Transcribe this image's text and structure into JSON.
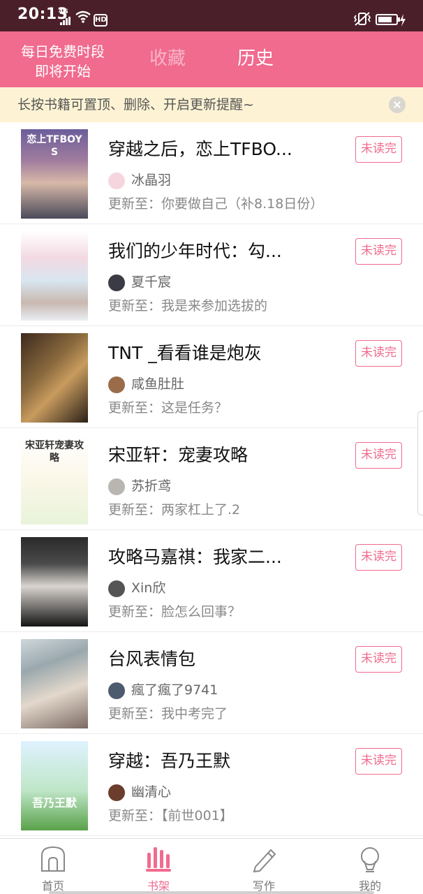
{
  "status_bar": {
    "time": "20:13",
    "network": "4G",
    "hd": "HD",
    "battery_level": 0.8
  },
  "header": {
    "promo_line1": "每日免费时段",
    "promo_line2": "即将开始",
    "tabs": [
      {
        "label": "收藏",
        "active": false
      },
      {
        "label": "历史",
        "active": true
      }
    ]
  },
  "tip_bar": {
    "text": "长按书籍可置顶、删除、开启更新提醒~"
  },
  "books": [
    {
      "title": "穿越之后，恋上TFBO...",
      "author": "冰晶羽",
      "update_prefix": "更新至：",
      "update": "你要做自己（补8.18日份）",
      "badge": "未读完",
      "cover_text": "恋上TFBOYS"
    },
    {
      "title": "我们的少年时代：勾...",
      "author": "夏千宸",
      "update_prefix": "更新至：",
      "update": "我是来参加选拔的",
      "badge": "未读完",
      "cover_text": ""
    },
    {
      "title": "TNT _看看谁是炮灰",
      "author": "咸鱼肚肚",
      "update_prefix": "更新至：",
      "update": "这是任务？",
      "badge": "未读完",
      "cover_text": ""
    },
    {
      "title": "宋亚轩：宠妻攻略",
      "author": "苏折鸢",
      "update_prefix": "更新至：",
      "update": "两家杠上了.2",
      "badge": "未读完",
      "cover_text": "宋亚轩宠妻攻略"
    },
    {
      "title": "攻略马嘉祺：我家二...",
      "author": "Xin欣",
      "update_prefix": "更新至：",
      "update": "脸怎么回事？",
      "badge": "未读完",
      "cover_text": ""
    },
    {
      "title": "台风表情包",
      "author": "瘋了瘋了9741",
      "update_prefix": "更新至：",
      "update": "我中考完了",
      "badge": "未读完",
      "cover_text": ""
    },
    {
      "title": "穿越：吾乃王默",
      "author": "幽清心",
      "update_prefix": "更新至：",
      "update": "【前世001】",
      "badge": "未读完",
      "cover_text": "吾乃王默"
    }
  ],
  "bottom_nav": [
    {
      "label": "首页",
      "icon": "home-icon",
      "active": false
    },
    {
      "label": "书架",
      "icon": "bookshelf-icon",
      "active": true
    },
    {
      "label": "写作",
      "icon": "pen-icon",
      "active": false
    },
    {
      "label": "我的",
      "icon": "profile-icon",
      "active": false
    }
  ],
  "colors": {
    "accent": "#f06b8e",
    "status_bar": "#4a1f2a",
    "tip_bg": "#fdf3d4"
  }
}
